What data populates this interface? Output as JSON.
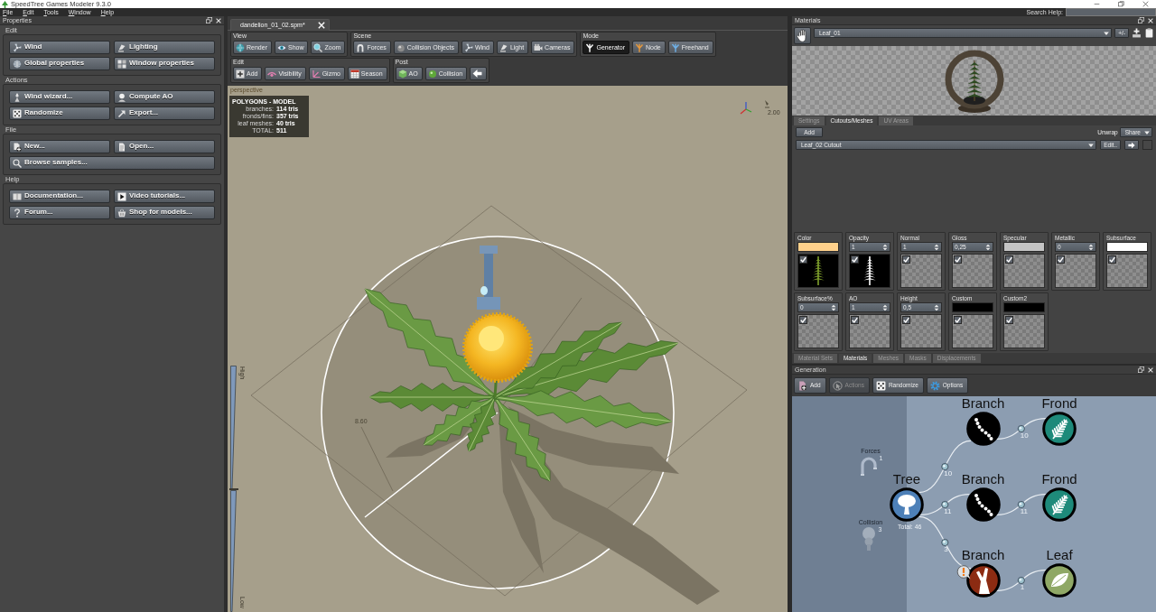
{
  "window": {
    "title": "SpeedTree Games Modeler 9.3.0"
  },
  "menu": [
    "File",
    "Edit",
    "Tools",
    "Window",
    "Help"
  ],
  "search": {
    "label": "Search Help:"
  },
  "properties": {
    "title": "Properties",
    "groups": [
      {
        "title": "Edit",
        "buttons": [
          "Wind",
          "Lighting",
          "Global properties",
          "Window properties"
        ]
      },
      {
        "title": "Actions",
        "buttons": [
          "Wind wizard...",
          "Compute AO",
          "Randomize",
          "Export..."
        ]
      },
      {
        "title": "File",
        "buttons": [
          "New...",
          "Open...",
          "Browse samples..."
        ]
      },
      {
        "title": "Help",
        "buttons": [
          "Documentation...",
          "Video tutorials...",
          "Forum...",
          "Shop for models..."
        ]
      }
    ]
  },
  "document_tabs": [
    {
      "label": "dandelion_01_02.spm*",
      "selected": true
    }
  ],
  "toolbar": [
    [
      {
        "title": "View",
        "buttons": [
          {
            "label": "Render"
          },
          {
            "label": "Show"
          },
          {
            "label": "Zoom"
          }
        ]
      },
      {
        "title": "Scene",
        "buttons": [
          {
            "label": "Forces"
          },
          {
            "label": "Collision Objects"
          },
          {
            "label": "Wind"
          },
          {
            "label": "Light"
          },
          {
            "label": "Cameras"
          }
        ]
      },
      {
        "title": "Mode",
        "buttons": [
          {
            "label": "Generator",
            "selected": true
          },
          {
            "label": "Node",
            "selected": false
          },
          {
            "label": "Freehand",
            "selected": false
          }
        ]
      }
    ],
    [
      {
        "title": "Edit",
        "buttons": [
          {
            "label": "Add"
          },
          {
            "label": "Visibility"
          },
          {
            "label": "Gizmo"
          },
          {
            "label": "Season"
          }
        ]
      },
      {
        "title": "Post",
        "buttons": [
          {
            "label": "AO"
          },
          {
            "label": "Collision"
          }
        ]
      }
    ]
  ],
  "viewport": {
    "camera": "perspective",
    "stats": {
      "title": "POLYGONS - MODEL",
      "rows": [
        {
          "label": "branches:",
          "value": "114 tris"
        },
        {
          "label": "fronds/fins:",
          "value": "357 tris"
        },
        {
          "label": "leaf meshes:",
          "value": "40 tris"
        },
        {
          "label": "TOTAL:",
          "value": "511"
        }
      ]
    },
    "axis_label": "2.00",
    "radius_label": "8.60",
    "lod_slider": {
      "top_label": "High",
      "bottom_label": "Low",
      "level": 0.5
    }
  },
  "materials": {
    "title": "Materials",
    "material": "Leaf_01",
    "plus_minus": "+/-",
    "tabs": [
      {
        "label": "Settings",
        "selected": false
      },
      {
        "label": "Cutouts/Meshes",
        "selected": true
      },
      {
        "label": "UV Areas",
        "selected": false
      }
    ],
    "add_button": "Add",
    "unwrap": {
      "label": "Unwrap",
      "value": "Share"
    },
    "cutout": {
      "value": "Leaf_02 Cutout",
      "edit_button": "Edit.."
    },
    "channels": [
      {
        "label": "Color",
        "kind": "swatch",
        "color": "#ffd18b",
        "checked": true,
        "texture": true
      },
      {
        "label": "Opacity",
        "kind": "number",
        "value": "1",
        "checked": true,
        "texture": true
      },
      {
        "label": "Normal",
        "kind": "number",
        "value": "1",
        "checked": true,
        "texture": false
      },
      {
        "label": "Gloss",
        "kind": "number",
        "value": "0,25",
        "checked": true,
        "texture": false
      },
      {
        "label": "Specular",
        "kind": "swatch",
        "color": "#c4c4c4",
        "checked": true,
        "texture": false
      },
      {
        "label": "Metallic",
        "kind": "number",
        "value": "0",
        "checked": true,
        "texture": false
      },
      {
        "label": "Subsurface",
        "kind": "swatch",
        "color": "#ffffff",
        "checked": true,
        "texture": false
      },
      {
        "label": "Subsurface%",
        "kind": "number",
        "value": "0",
        "checked": true,
        "texture": false
      },
      {
        "label": "AO",
        "kind": "number",
        "value": "1",
        "checked": true,
        "texture": false
      },
      {
        "label": "Height",
        "kind": "number",
        "value": "0,5",
        "checked": true,
        "texture": false
      },
      {
        "label": "Custom",
        "kind": "swatch",
        "color": "#000000",
        "checked": true,
        "texture": false
      },
      {
        "label": "Custom2",
        "kind": "swatch",
        "color": "#000000",
        "checked": true,
        "texture": false
      }
    ],
    "bottom_tabs": [
      {
        "label": "Material Sets",
        "selected": false
      },
      {
        "label": "Materials",
        "selected": true
      },
      {
        "label": "Meshes",
        "selected": false
      },
      {
        "label": "Masks",
        "selected": false
      },
      {
        "label": "Displacements",
        "selected": false
      }
    ]
  },
  "generation": {
    "title": "Generation",
    "buttons": [
      {
        "label": "Add",
        "disabled": false
      },
      {
        "label": "Actions",
        "disabled": true
      },
      {
        "label": "Randomize",
        "disabled": false
      },
      {
        "label": "Options",
        "disabled": false
      }
    ],
    "side_items": [
      {
        "label": "Forces",
        "count": "1"
      },
      {
        "label": "Collision",
        "count": "3"
      }
    ],
    "graph": {
      "label": "Tree",
      "kind": "tree",
      "total": "Total: 46",
      "children": [
        {
          "label": "Branch",
          "kind": "branch",
          "count": "10",
          "warning": false,
          "children": [
            {
              "label": "Frond",
              "kind": "frond",
              "count": "10",
              "warning": false
            }
          ]
        },
        {
          "label": "Branch",
          "kind": "branch",
          "count": "11",
          "warning": false,
          "children": [
            {
              "label": "Frond",
              "kind": "frond",
              "count": "11",
              "warning": false
            }
          ]
        },
        {
          "label": "Branch",
          "kind": "trunk",
          "count": "3",
          "warning": true,
          "children": [
            {
              "label": "Leaf",
              "kind": "leaf",
              "count": "1",
              "warning": false
            }
          ]
        }
      ]
    }
  }
}
